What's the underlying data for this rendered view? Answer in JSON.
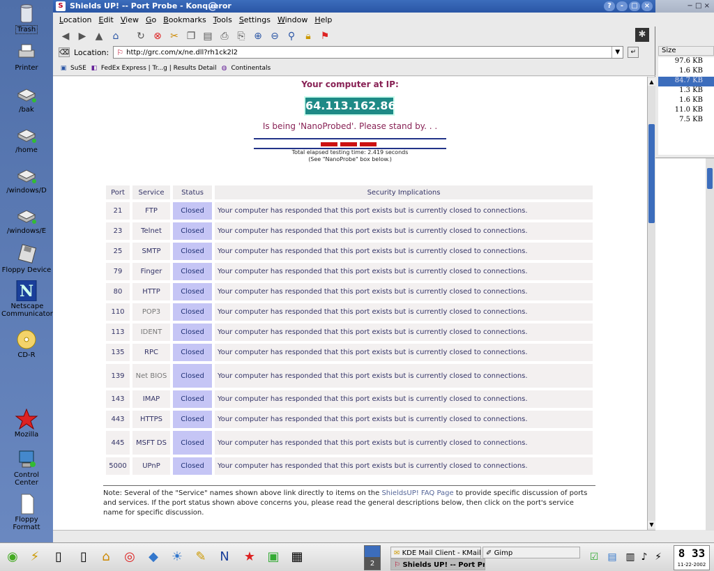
{
  "desktop": {
    "icons": [
      {
        "label": "Trash",
        "icon": "trash-icon"
      },
      {
        "label": "Printer",
        "icon": "printer-icon"
      },
      {
        "label": "/bak",
        "icon": "drive-icon"
      },
      {
        "label": "/home",
        "icon": "drive-icon"
      },
      {
        "label": "/windows/D",
        "icon": "drive-icon"
      },
      {
        "label": "/windows/E",
        "icon": "drive-icon"
      },
      {
        "label": "Floppy Device",
        "icon": "floppy-icon"
      },
      {
        "label": "Netscape Communicator",
        "icon": "netscape-icon"
      },
      {
        "label": "CD-R",
        "icon": "cd-icon"
      },
      {
        "label": "Mozilla",
        "icon": "mozilla-icon"
      },
      {
        "label": "Control Center",
        "icon": "control-center-icon"
      },
      {
        "label": "Floppy Formatt",
        "icon": "document-icon"
      }
    ]
  },
  "window": {
    "title": "Shields UP! -- Port Probe - Konqueror",
    "buttons": [
      "?",
      "-",
      "□",
      "×"
    ]
  },
  "menu": [
    {
      "u": "L",
      "rest": "ocation"
    },
    {
      "u": "E",
      "rest": "dit"
    },
    {
      "u": "V",
      "rest": "iew"
    },
    {
      "u": "G",
      "rest": "o"
    },
    {
      "u": "B",
      "rest": "ookmarks"
    },
    {
      "u": "T",
      "rest": "ools"
    },
    {
      "u": "S",
      "rest": "ettings"
    },
    {
      "u": "W",
      "rest": "indow"
    },
    {
      "u": "H",
      "rest": "elp"
    }
  ],
  "location": {
    "label": "Location:",
    "url": "http://grc.com/x/ne.dll?rh1ck2l2"
  },
  "bookmarks": [
    {
      "label": "SuSE",
      "icon": "suse-icon"
    },
    {
      "label": "FedEx Express | Tr...g | Results Detail",
      "icon": "fedex-icon"
    },
    {
      "label": "Continentals",
      "icon": "bookmark-folder-icon"
    }
  ],
  "page": {
    "ip_heading": "Your computer at IP:",
    "ip": "64.113.162.86",
    "probing": "Is being 'NanoProbed'. Please stand by. . .",
    "elapsed": "Total elapsed testing time: 2.419 seconds",
    "see_note": "(See \"NanoProbe\" box below.)",
    "table_headers": [
      "Port",
      "Service",
      "Status",
      "Security Implications"
    ],
    "rows": [
      {
        "port": "21",
        "service": "FTP",
        "status": "Closed",
        "impl": "Your computer has responded that this port exists but is currently closed to connections."
      },
      {
        "port": "23",
        "service": "Telnet",
        "status": "Closed",
        "impl": "Your computer has responded that this port exists but is currently closed to connections."
      },
      {
        "port": "25",
        "service": "SMTP",
        "status": "Closed",
        "impl": "Your computer has responded that this port exists but is currently closed to connections."
      },
      {
        "port": "79",
        "service": "Finger",
        "status": "Closed",
        "impl": "Your computer has responded that this port exists but is currently closed to connections."
      },
      {
        "port": "80",
        "service": "HTTP",
        "status": "Closed",
        "impl": "Your computer has responded that this port exists but is currently closed to connections."
      },
      {
        "port": "110",
        "service": "POP3",
        "status": "Closed",
        "impl": "Your computer has responded that this port exists but is currently closed to connections."
      },
      {
        "port": "113",
        "service": "IDENT",
        "status": "Closed",
        "impl": "Your computer has responded that this port exists but is currently closed to connections."
      },
      {
        "port": "135",
        "service": "RPC",
        "status": "Closed",
        "impl": "Your computer has responded that this port exists but is currently closed to connections."
      },
      {
        "port": "139",
        "service": "Net BIOS",
        "status": "Closed",
        "impl": "Your computer has responded that this port exists but is currently closed to connections."
      },
      {
        "port": "143",
        "service": "IMAP",
        "status": "Closed",
        "impl": "Your computer has responded that this port exists but is currently closed to connections."
      },
      {
        "port": "443",
        "service": "HTTPS",
        "status": "Closed",
        "impl": "Your computer has responded that this port exists but is currently closed to connections."
      },
      {
        "port": "445",
        "service": "MSFT DS",
        "status": "Closed",
        "impl": "Your computer has responded that this port exists but is currently closed to connections."
      },
      {
        "port": "5000",
        "service": "UPnP",
        "status": "Closed",
        "impl": "Your computer has responded that this port exists but is currently closed to connections."
      }
    ],
    "note_before": "Note: Several of the \"Service\" names shown above link directly to items on the ",
    "note_link": "ShieldsUP! FAQ Page",
    "note_after": " to provide specific discussion of ports and services. If the port status shown above concerns you, please read the general descriptions below, then click on the port's service name for specific discussion."
  },
  "side_panel": {
    "column": "Size",
    "sizes": [
      "97.6 KB",
      "1.6 KB",
      "84.7 KB",
      "1.3 KB",
      "1.6 KB",
      "11.0 KB",
      "7.5 KB"
    ],
    "selected_index": 2
  },
  "taskbar": {
    "pager_page": "2",
    "tasks": [
      {
        "label": "KDE Mail Client - KMail",
        "icon": "kmail-icon"
      },
      {
        "label": "Gimp",
        "icon": "gimp-icon"
      },
      {
        "label": "Shields UP! -- Port Pro",
        "icon": "konqueror-icon"
      }
    ],
    "clock_time": "8 33",
    "clock_date": "11-22-2002"
  }
}
